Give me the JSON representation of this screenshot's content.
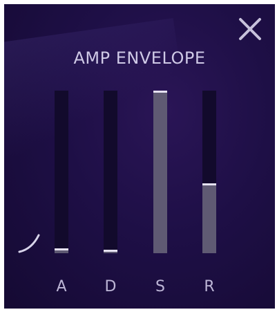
{
  "panel": {
    "title": "AMP ENVELOPE",
    "close_icon": "close-icon",
    "curve_icon": "curve-icon"
  },
  "sliders": [
    {
      "label": "A",
      "value": 0.03
    },
    {
      "label": "D",
      "value": 0.02
    },
    {
      "label": "S",
      "value": 1.0
    },
    {
      "label": "R",
      "value": 0.43
    }
  ],
  "colors": {
    "panel_bg": "#1e0f46",
    "track": "#120a2c",
    "fill": "#5f5a73",
    "handle": "#e6e2f2",
    "text": "#cfc9e6"
  }
}
